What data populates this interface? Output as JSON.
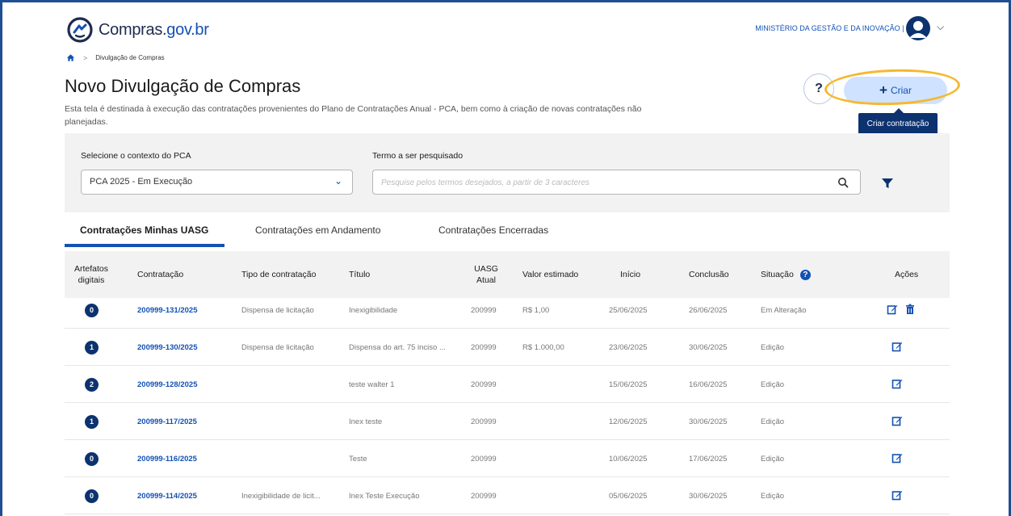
{
  "header": {
    "logo_text_main": "Compras.",
    "logo_text_accent": "gov.br",
    "org": "MINISTÉRIO DA GESTÃO E DA INOVAÇÃO | 200999"
  },
  "breadcrumb": {
    "current": "Divulgação de Compras"
  },
  "page": {
    "title": "Novo Divulgação de Compras",
    "description": "Esta tela é destinada à execução das contratações provenientes do Plano de Contratações Anual - PCA, bem como à criação de novas contratações não planejadas."
  },
  "actions": {
    "help_label": "?",
    "create_label": "Criar",
    "tooltip": "Criar contratação"
  },
  "filter": {
    "context_label": "Selecione o contexto do PCA",
    "context_value": "PCA 2025 - Em Execução",
    "search_label": "Termo a ser pesquisado",
    "search_placeholder": "Pesquise pelos termos desejados, a partir de 3 caracteres"
  },
  "tabs": [
    {
      "label": "Contratações Minhas UASG"
    },
    {
      "label": "Contratações em Andamento"
    },
    {
      "label": "Contratações Encerradas"
    }
  ],
  "table": {
    "headers": {
      "artefatos": "Artefatos digitais",
      "contratacao": "Contratação",
      "tipo": "Tipo de contratação",
      "titulo": "Título",
      "uasg": "UASG Atual",
      "valor": "Valor estimado",
      "inicio": "Início",
      "conclusao": "Conclusão",
      "situacao": "Situação",
      "acoes": "Ações"
    },
    "rows": [
      {
        "artefatos": "0",
        "contratacao": "200999-131/2025",
        "tipo": "Dispensa de licitação",
        "titulo": "Inexigibilidade",
        "uasg": "200999",
        "valor": "R$ 1,00",
        "inicio": "25/06/2025",
        "conclusao": "26/06/2025",
        "situacao": "Em Alteração"
      },
      {
        "artefatos": "1",
        "contratacao": "200999-130/2025",
        "tipo": "Dispensa de licitação",
        "titulo": "Dispensa do art. 75 inciso ...",
        "uasg": "200999",
        "valor": "R$ 1.000,00",
        "inicio": "23/06/2025",
        "conclusao": "30/06/2025",
        "situacao": "Edição"
      },
      {
        "artefatos": "2",
        "contratacao": "200999-128/2025",
        "tipo": "",
        "titulo": "teste walter 1",
        "uasg": "200999",
        "valor": "",
        "inicio": "15/06/2025",
        "conclusao": "16/06/2025",
        "situacao": "Edição"
      },
      {
        "artefatos": "1",
        "contratacao": "200999-117/2025",
        "tipo": "",
        "titulo": "Inex teste",
        "uasg": "200999",
        "valor": "",
        "inicio": "12/06/2025",
        "conclusao": "30/06/2025",
        "situacao": "Edição"
      },
      {
        "artefatos": "0",
        "contratacao": "200999-116/2025",
        "tipo": "",
        "titulo": "Teste",
        "uasg": "200999",
        "valor": "",
        "inicio": "10/06/2025",
        "conclusao": "17/06/2025",
        "situacao": "Edição"
      },
      {
        "artefatos": "0",
        "contratacao": "200999-114/2025",
        "tipo": "Inexigibilidade de licit...",
        "titulo": "Inex Teste Execução",
        "uasg": "200999",
        "valor": "",
        "inicio": "05/06/2025",
        "conclusao": "30/06/2025",
        "situacao": "Edição"
      }
    ]
  },
  "colors": {
    "primary": "#1351b4",
    "dark": "#0c326f",
    "highlight": "#f5b82e",
    "panel": "#f2f2f2"
  }
}
